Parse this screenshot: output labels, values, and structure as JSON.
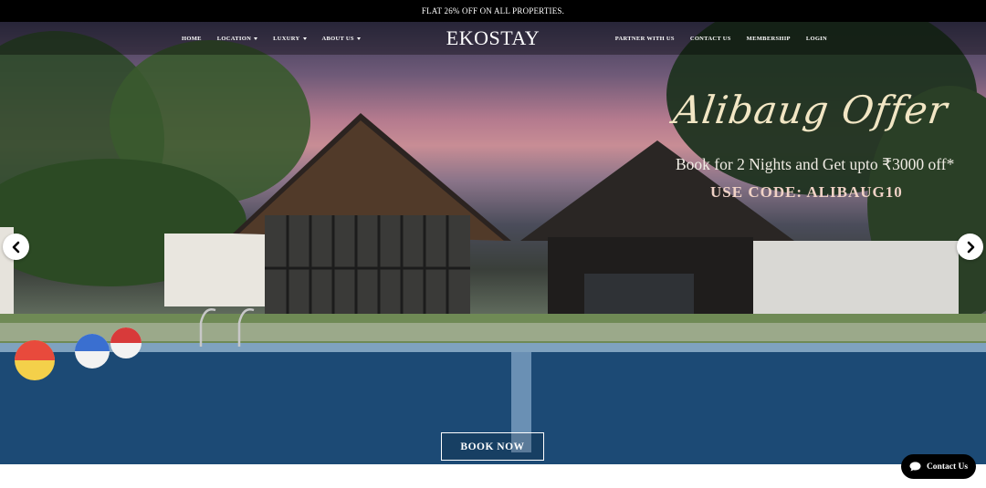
{
  "promo_bar": {
    "text": "FLAT 26% OFF ON ALL PROPERTIES."
  },
  "nav": {
    "left_items": [
      {
        "label": "HOME",
        "dropdown": false
      },
      {
        "label": "LOCATION",
        "dropdown": true
      },
      {
        "label": "LUXURY",
        "dropdown": true
      },
      {
        "label": "ABOUT US",
        "dropdown": true
      }
    ],
    "logo": "EKOSTAY",
    "right_items": [
      {
        "label": "PARTNER WITH US"
      },
      {
        "label": "CONTACT US"
      },
      {
        "label": "MEMBERSHIP"
      },
      {
        "label": "LOGIN"
      }
    ]
  },
  "hero": {
    "script_title": "Alibaug Offer",
    "offer_line": "Book for 2 Nights and Get upto ₹3000 off*",
    "code_line": "USE CODE: ALIBAUG10",
    "cta_label": "BOOK NOW",
    "prev_icon": "chevron-left-icon",
    "next_icon": "chevron-right-icon"
  },
  "chat": {
    "label": "Contact Us",
    "icon": "chat-bubble-icon"
  },
  "colors": {
    "promo_bg": "#000000",
    "script_gold": "#f2e6c4",
    "code_pink": "#f0d2c6",
    "pool_blue": "#1f4e78"
  }
}
